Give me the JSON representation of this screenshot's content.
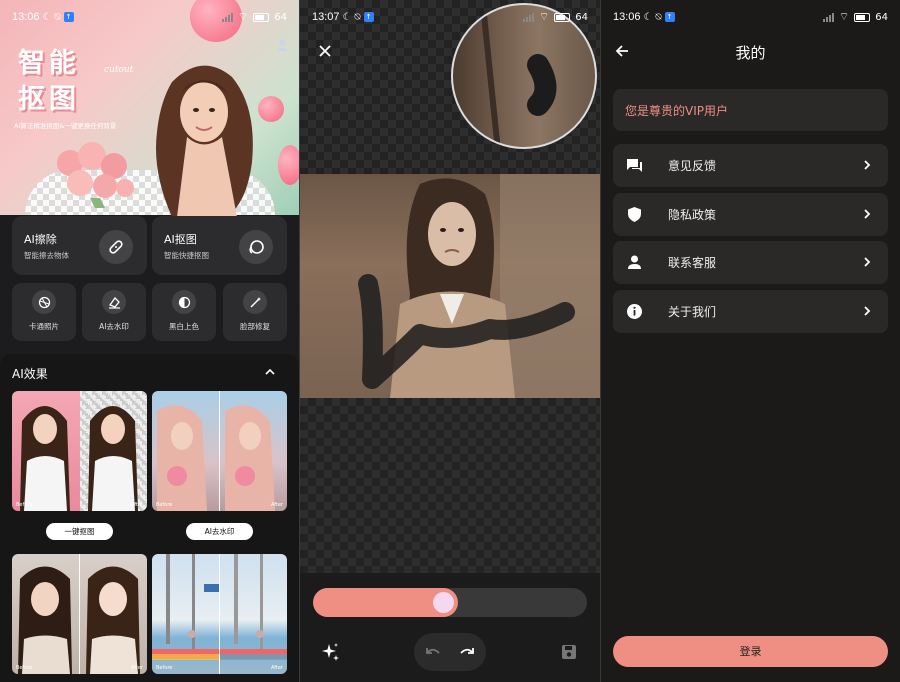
{
  "status_bars": [
    {
      "time": "13:06",
      "battery": "64"
    },
    {
      "time": "13:07",
      "battery": "64"
    },
    {
      "time": "13:06",
      "battery": "64"
    }
  ],
  "home": {
    "hero": {
      "title_line1": "智能",
      "title_line2": "抠图",
      "subtitle_en": "cutout",
      "description": "AI算法精准抠图&一键更换任何背景"
    },
    "big_cards": [
      {
        "title": "AI擦除",
        "subtitle": "智能擦去物体",
        "icon": "bandage-icon"
      },
      {
        "title": "AI抠图",
        "subtitle": "智能快捷抠图",
        "icon": "lasso-icon"
      }
    ],
    "small_cards": [
      {
        "label": "卡通照片",
        "icon": "ball-icon"
      },
      {
        "label": "AI去水印",
        "icon": "eraser-icon"
      },
      {
        "label": "黑白上色",
        "icon": "contrast-icon"
      },
      {
        "label": "脸部修复",
        "icon": "wand-icon"
      }
    ],
    "effects": {
      "title": "AI效果",
      "items": [
        {
          "button": "一键抠图",
          "before": "Before",
          "after": "After"
        },
        {
          "button": "AI去水印",
          "before": "Before",
          "after": "After"
        },
        {
          "button": "",
          "before": "Before",
          "after": "After"
        },
        {
          "button": "",
          "before": "Before",
          "after": "After"
        }
      ]
    }
  },
  "editor": {
    "brush_size_fraction": 0.53
  },
  "mine": {
    "title": "我的",
    "vip_text": "您是尊贵的VIP用户",
    "menu": [
      {
        "label": "意见反馈",
        "icon": "feedback-icon"
      },
      {
        "label": "隐私政策",
        "icon": "shield-icon"
      },
      {
        "label": "联系客服",
        "icon": "person-icon"
      },
      {
        "label": "关于我们",
        "icon": "info-icon"
      }
    ],
    "login_label": "登录"
  },
  "colors": {
    "accent": "#ef8f83",
    "card": "#2c2c2e",
    "knob": "#f5d7f0"
  }
}
